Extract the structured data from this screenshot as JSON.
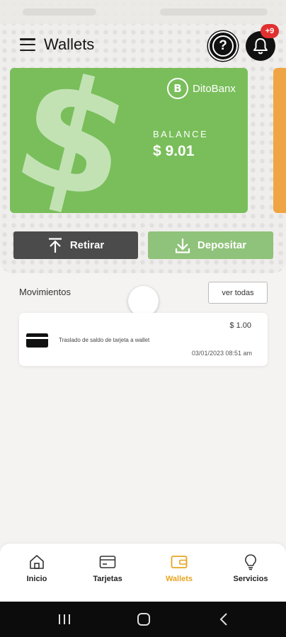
{
  "header": {
    "title": "Wallets",
    "help_icon_text": "?",
    "notification_badge": "+9"
  },
  "wallet_card": {
    "brand_name": "DitoBanx",
    "brand_logo_text": "B",
    "balance_label": "BALANCE",
    "balance_value": "$ 9.01",
    "background_symbol": "$",
    "color": "#79be5a",
    "next_card_color": "#f0a544"
  },
  "actions": {
    "withdraw_label": "Retirar",
    "deposit_label": "Depositar"
  },
  "movements": {
    "title": "Movimientos",
    "see_all_label": "ver todas",
    "items": [
      {
        "icon": "credit-card-icon",
        "description": "Traslado de saldo de tarjeta a wallet",
        "amount": "$ 1.00",
        "date": "03/01/2023 08:51 am"
      }
    ]
  },
  "bottom_nav": {
    "items": [
      {
        "label": "Inicio",
        "icon": "home-icon",
        "active": false
      },
      {
        "label": "Tarjetas",
        "icon": "card-icon",
        "active": false
      },
      {
        "label": "Wallets",
        "icon": "wallet-icon",
        "active": true
      },
      {
        "label": "Servicios",
        "icon": "lightbulb-icon",
        "active": false
      }
    ],
    "active_color": "#e6a521"
  }
}
